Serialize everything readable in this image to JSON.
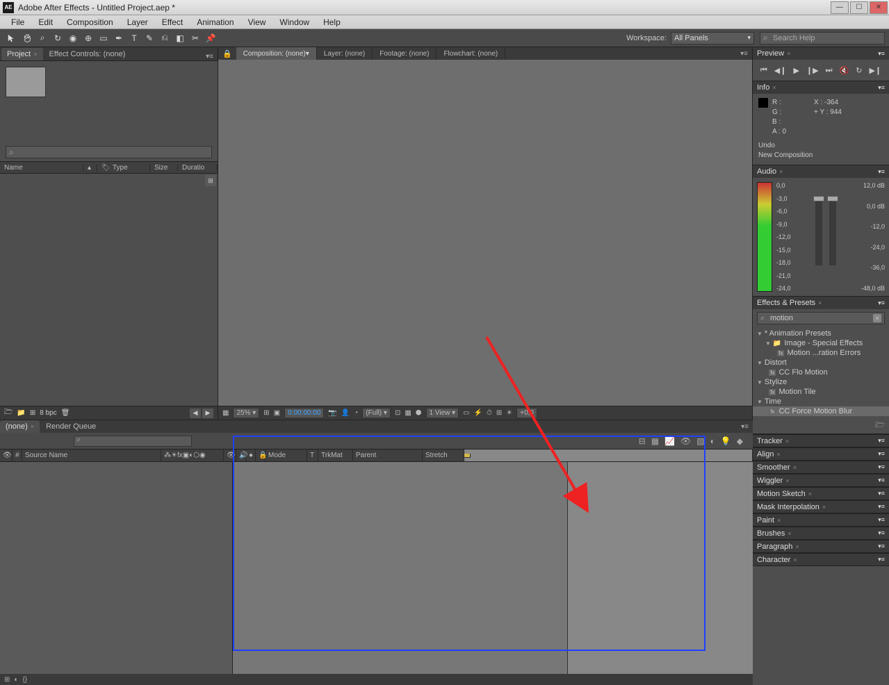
{
  "titlebar": {
    "app": "Adobe After Effects",
    "file": "Untitled Project.aep *"
  },
  "menu": [
    "File",
    "Edit",
    "Composition",
    "Layer",
    "Effect",
    "Animation",
    "View",
    "Window",
    "Help"
  ],
  "toolbar": {
    "workspace_label": "Workspace:",
    "workspace_value": "All Panels",
    "search_placeholder": "Search Help"
  },
  "project": {
    "tab": "Project",
    "tab2": "Effect Controls: (none)",
    "headers": [
      "Name",
      "Type",
      "Size",
      "Duratio"
    ],
    "bpc": "8 bpc"
  },
  "viewer": {
    "tabs": [
      "Composition: (none)",
      "Layer: (none)",
      "Footage: (none)",
      "Flowchart: (none)"
    ],
    "footer": {
      "zoom": "25%",
      "time": "0:00:00:00",
      "res": "(Full)",
      "view": "1 View"
    }
  },
  "preview": {
    "title": "Preview"
  },
  "info": {
    "title": "Info",
    "r": "R :",
    "g": "G :",
    "b": "B :",
    "a": "A : 0",
    "x": "X : -364",
    "y": "Y :  944",
    "status1": "Undo",
    "status2": "New Composition"
  },
  "audio": {
    "title": "Audio",
    "left_ticks": [
      "0,0",
      "-3,0",
      "-6,0",
      "-9,0",
      "-12,0",
      "-15,0",
      "-18,0",
      "-21,0",
      "-24,0"
    ],
    "right_ticks": [
      "12,0 dB",
      "0,0 dB",
      "-12,0",
      "-24,0",
      "-36,0",
      "-48,0 dB"
    ]
  },
  "effects_presets": {
    "title": "Effects & Presets",
    "search": "motion",
    "tree": [
      {
        "t": "* Animation Presets",
        "lvl": 0,
        "tw": "▼"
      },
      {
        "t": "Image - Special Effects",
        "lvl": 1,
        "tw": "▼",
        "ic": "📁"
      },
      {
        "t": "Motion ...ration Errors",
        "lvl": 2,
        "ic": "fx"
      },
      {
        "t": "Distort",
        "lvl": 0,
        "tw": "▼"
      },
      {
        "t": "CC Flo Motion",
        "lvl": 1,
        "ic": "fx"
      },
      {
        "t": "Stylize",
        "lvl": 0,
        "tw": "▼"
      },
      {
        "t": "Motion Tile",
        "lvl": 1,
        "ic": "fx"
      },
      {
        "t": "Time",
        "lvl": 0,
        "tw": "▼"
      },
      {
        "t": "CC Force Motion Blur",
        "lvl": 1,
        "ic": "fx",
        "sel": true
      }
    ]
  },
  "right_panels": [
    "Tracker",
    "Align",
    "Smoother",
    "Wiggler",
    "Motion Sketch",
    "Mask Interpolation",
    "Paint",
    "Brushes",
    "Paragraph",
    "Character"
  ],
  "timeline": {
    "tabs": [
      "(none)",
      "Render Queue"
    ],
    "headers": [
      "#",
      "Source Name",
      "Mode",
      "T",
      "TrkMat",
      "Parent",
      "Stretch"
    ]
  }
}
